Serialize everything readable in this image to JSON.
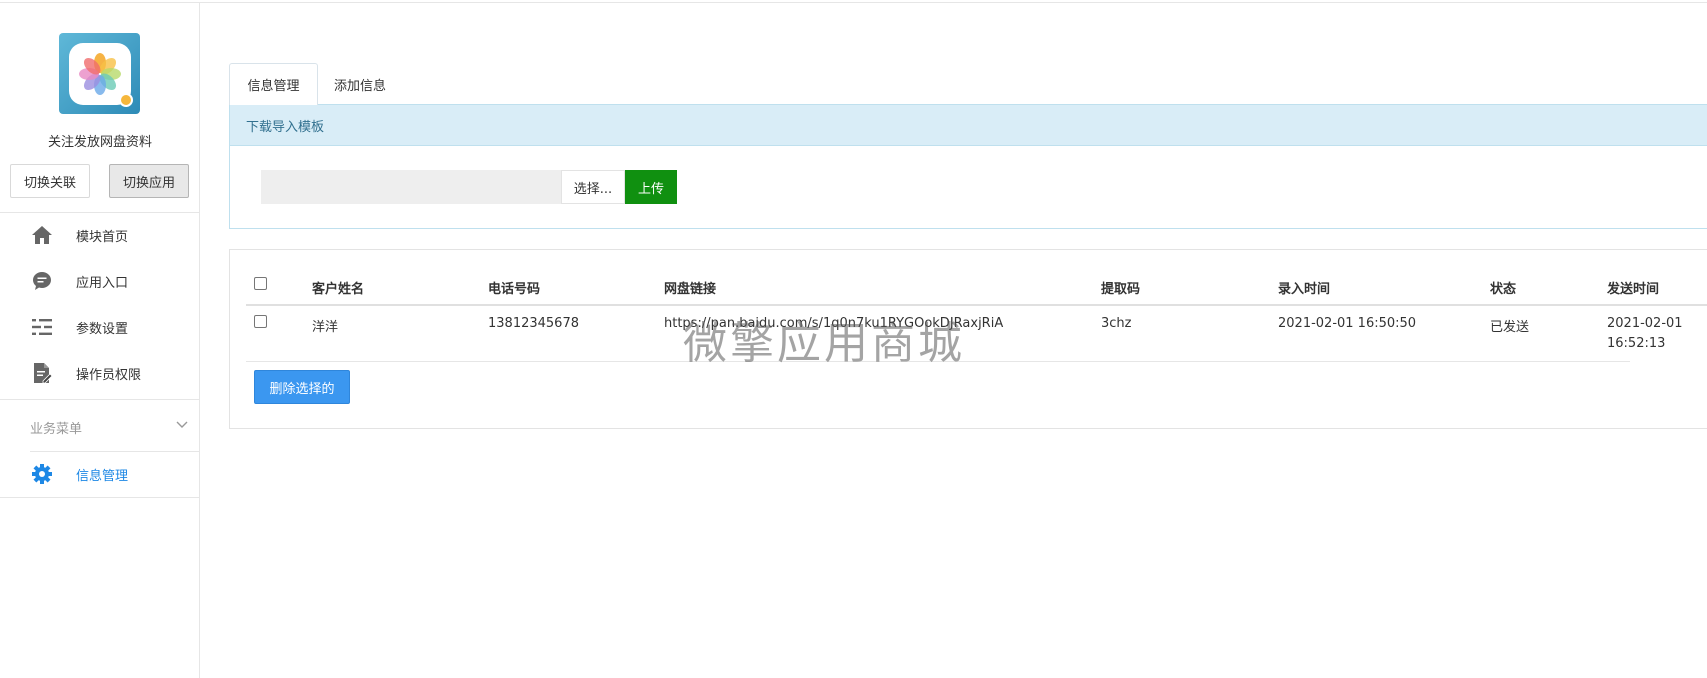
{
  "sidebar": {
    "app_name": "关注发放网盘资料",
    "switch_relation_label": "切换关联",
    "switch_app_label": "切换应用",
    "menu": [
      {
        "label": "模块首页",
        "icon": "home-icon"
      },
      {
        "label": "应用入口",
        "icon": "chat-bubble-icon"
      },
      {
        "label": "参数设置",
        "icon": "sliders-icon"
      },
      {
        "label": "操作员权限",
        "icon": "document-edit-icon"
      }
    ],
    "business_group": {
      "title": "业务菜单",
      "icon": "chevron-down-icon",
      "items": [
        {
          "label": "信息管理",
          "icon": "gear-icon",
          "active": true
        }
      ]
    }
  },
  "tabs": [
    {
      "label": "信息管理",
      "active": true
    },
    {
      "label": "添加信息",
      "active": false
    }
  ],
  "upload_panel": {
    "header": "下载导入模板",
    "file_path": "",
    "choose_label": "选择...",
    "upload_label": "上传"
  },
  "table": {
    "columns": [
      "客户姓名",
      "电话号码",
      "网盘链接",
      "提取码",
      "录入时间",
      "状态",
      "发送时间"
    ],
    "rows": [
      {
        "name": "洋洋",
        "phone": "13812345678",
        "link": "https://pan.baidu.com/s/1q0n7ku1RYGOokDJRaxjRiA",
        "code": "3chz",
        "entry_time": "2021-02-01 16:50:50",
        "status": "已发送",
        "send_time_date": "2021-02-01",
        "send_time_clock": "16:52:13"
      }
    ],
    "delete_label": "删除选择的"
  },
  "watermark": "微擎应用商城",
  "colors": {
    "accent": "#1e88e5",
    "upload_green": "#109010",
    "delete_blue": "#3b97f0",
    "panel_header_bg": "#d9edf7",
    "panel_header_text": "#31708f"
  }
}
